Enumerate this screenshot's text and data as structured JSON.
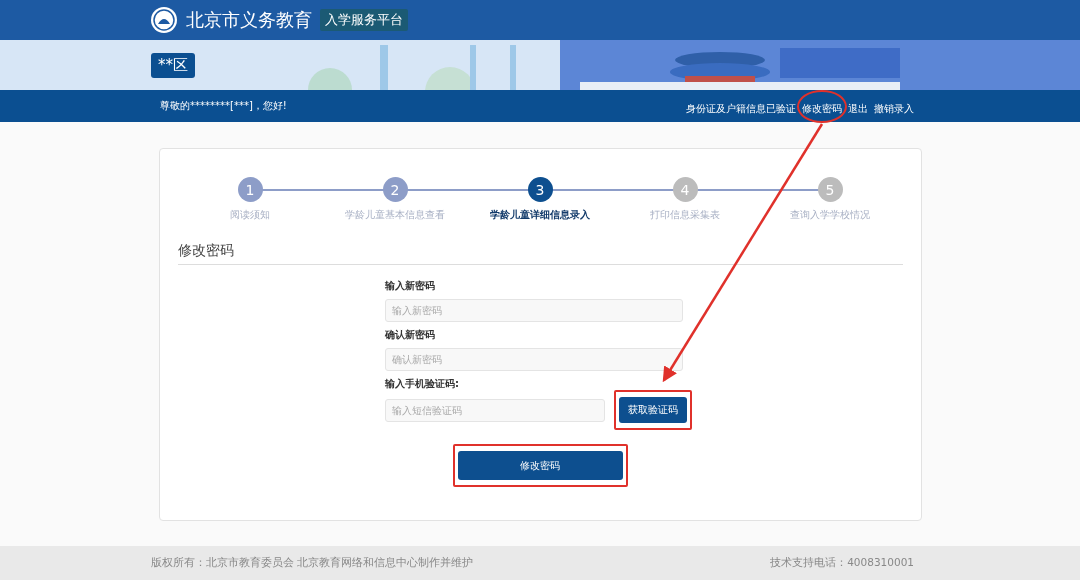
{
  "header": {
    "site_title": "北京市义务教育",
    "platform": "入学服务平台",
    "district": "**区"
  },
  "nav": {
    "greeting": "尊敬的********[***]，您好!",
    "links": [
      {
        "label": "身份证及户籍信息已验证",
        "highlighted": false
      },
      {
        "label": "修改密码",
        "highlighted": true
      },
      {
        "label": "退出",
        "highlighted": false
      },
      {
        "label": "撤销录入",
        "highlighted": false
      }
    ]
  },
  "steps": [
    {
      "number": "1",
      "label": "阅读须知",
      "completed": true,
      "selected": false
    },
    {
      "number": "2",
      "label": "学龄儿童基本信息查看",
      "completed": true,
      "selected": false
    },
    {
      "number": "3",
      "label": "学龄儿童详细信息录入",
      "completed": false,
      "selected": true
    },
    {
      "number": "4",
      "label": "打印信息采集表",
      "completed": false,
      "selected": false
    },
    {
      "number": "5",
      "label": "查询入学学校情况",
      "completed": false,
      "selected": false
    }
  ],
  "form": {
    "title": "修改密码",
    "fields": [
      {
        "label": "输入新密码",
        "placeholder": "输入新密码"
      },
      {
        "label": "确认新密码",
        "placeholder": "确认新密码"
      },
      {
        "label": "输入手机验证码:",
        "placeholder": "输入短信验证码",
        "button": {
          "label": "获取验证码",
          "highlighted": true
        }
      }
    ],
    "submit": {
      "label": "修改密码",
      "highlighted": true
    }
  },
  "annotation_arrow": true,
  "footer": {
    "copyright": "版权所有：北京市教育委员会 北京教育网络和信息中心制作并维护",
    "support": "技术支持电话：4008310001"
  }
}
